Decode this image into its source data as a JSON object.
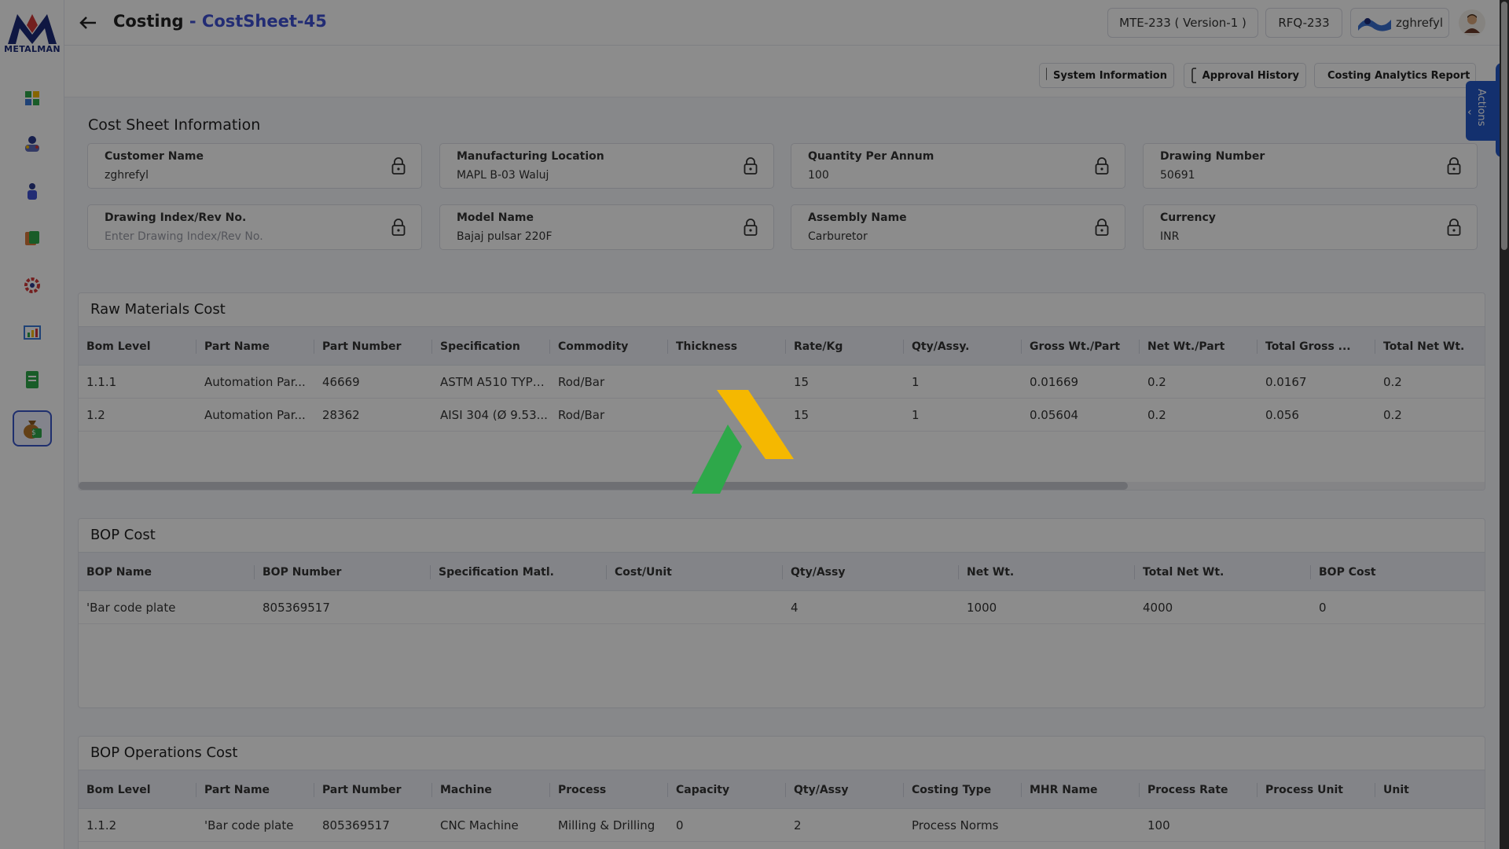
{
  "app": {
    "logo_text": "METALMAN",
    "title_main": "Costing",
    "title_separator": "-",
    "title_sub": "CostSheet-45"
  },
  "topbar": {
    "version_pill": "MTE-233 ( Version-1 )",
    "rfq_pill": "RFQ-233",
    "company_pill": "zghrefyl"
  },
  "subbar": {
    "system_information": "System Information",
    "approval_history": "Approval History",
    "costing_analytics_report": "Costing Analytics Report"
  },
  "actions_tab": {
    "label": "Actions"
  },
  "cost_sheet_info": {
    "title": "Cost Sheet Information",
    "fields": [
      {
        "label": "Customer Name",
        "value": "zghrefyl",
        "placeholder": ""
      },
      {
        "label": "Manufacturing Location",
        "value": "MAPL B-03 Waluj",
        "placeholder": ""
      },
      {
        "label": "Quantity Per Annum",
        "value": "100",
        "placeholder": ""
      },
      {
        "label": "Drawing Number",
        "value": "50691",
        "placeholder": ""
      },
      {
        "label": "Drawing Index/Rev No.",
        "value": "",
        "placeholder": "Enter Drawing Index/Rev No."
      },
      {
        "label": "Model Name",
        "value": "Bajaj pulsar 220F",
        "placeholder": ""
      },
      {
        "label": "Assembly Name",
        "value": "Carburetor",
        "placeholder": ""
      },
      {
        "label": "Currency",
        "value": "INR",
        "placeholder": ""
      }
    ]
  },
  "raw_materials": {
    "title": "Raw Materials Cost",
    "columns": [
      "Bom Level",
      "Part Name",
      "Part Number",
      "Specification",
      "Commodity",
      "Thickness",
      "Rate/Kg",
      "Qty/Assy.",
      "Gross Wt./Part",
      "Net Wt./Part",
      "Total Gross ...",
      "Total Net Wt."
    ],
    "rows": [
      [
        "1.1.1",
        "Automation Par...",
        "46669",
        "ASTM A510 TYPE ...",
        "Rod/Bar",
        "",
        "15",
        "1",
        "0.01669",
        "0.2",
        "0.0167",
        "0.2"
      ],
      [
        "1.2",
        "Automation Par...",
        "28362",
        "AISI 304 (Ø 9.53...",
        "Rod/Bar",
        "",
        "15",
        "1",
        "0.05604",
        "0.2",
        "0.056",
        "0.2"
      ]
    ]
  },
  "bop_cost": {
    "title": "BOP Cost",
    "columns": [
      "BOP Name",
      "BOP Number",
      "Specification Matl.",
      "Cost/Unit",
      "Qty/Assy",
      "Net Wt.",
      "Total Net Wt.",
      "BOP Cost"
    ],
    "rows": [
      [
        "'Bar code plate",
        "805369517",
        "",
        "",
        "4",
        "1000",
        "4000",
        "0"
      ]
    ]
  },
  "bop_operations": {
    "title": "BOP Operations Cost",
    "columns": [
      "Bom Level",
      "Part Name",
      "Part Number",
      "Machine",
      "Process",
      "Capacity",
      "Qty/Assy",
      "Costing Type",
      "MHR Name",
      "Process Rate",
      "Process Unit",
      "Unit"
    ],
    "rows": [
      [
        "1.1.2",
        "'Bar code plate",
        "805369517",
        "CNC Machine",
        "Milling & Drilling",
        "0",
        "2",
        "Process Norms",
        "",
        "100",
        "",
        ""
      ]
    ]
  },
  "colors": {
    "accent": "#3f51d4",
    "actions_tab": "#2458c9",
    "loader_yellow": "#f5b800",
    "loader_green": "#2ea84a"
  },
  "icons": [
    "dashboard-icon",
    "user-group-icon",
    "person-icon",
    "book-icon",
    "gear-icon",
    "chart-icon",
    "document-icon",
    "money-bag-icon",
    "lock-icon",
    "back-arrow-icon",
    "monitor-icon",
    "clipboard-check-icon",
    "analytics-icon",
    "chevron-left-icon"
  ]
}
